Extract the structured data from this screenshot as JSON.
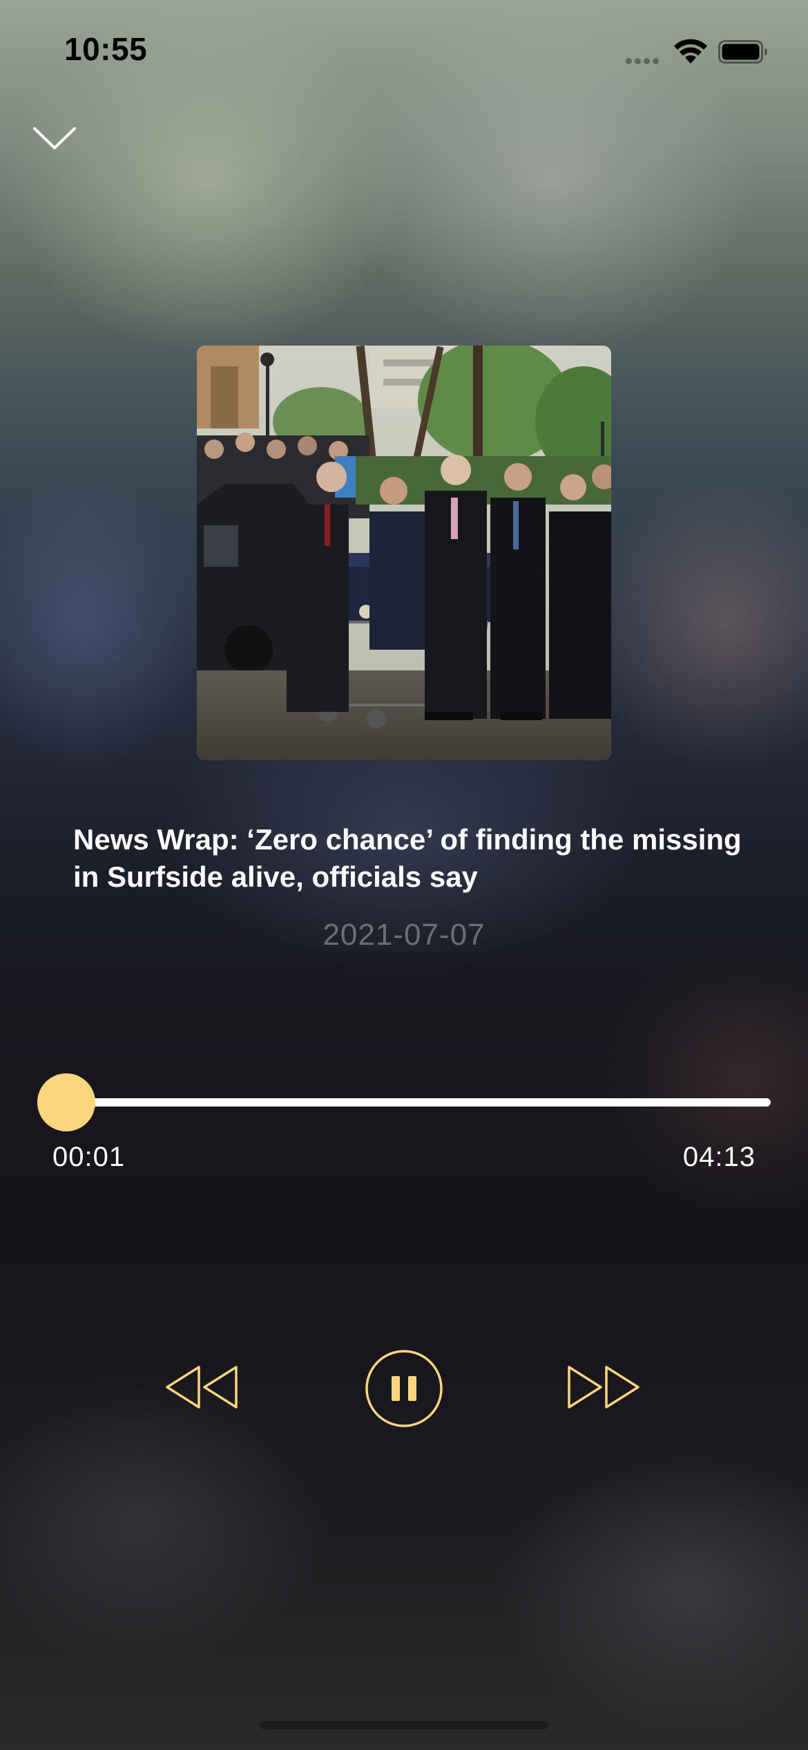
{
  "status_bar": {
    "time": "10:55",
    "signal_icon": "cellular-signal-icon",
    "wifi_icon": "wifi-icon",
    "battery_icon": "battery-icon"
  },
  "navigation": {
    "dismiss_icon": "chevron-down-icon"
  },
  "artwork": {
    "description_icon": "episode-artwork"
  },
  "episode": {
    "title": "News Wrap: ‘Zero chance’ of finding the missing in Surfside alive, officials say",
    "date": "2021-07-07"
  },
  "playback": {
    "elapsed": "00:01",
    "total": "04:13",
    "progress_fraction": 0.004,
    "state": "playing"
  },
  "controls": {
    "rewind_icon": "rewind-icon",
    "pause_icon": "pause-icon",
    "forward_icon": "fast-forward-icon"
  },
  "colors": {
    "accent": "#fdd57e",
    "text": "#ffffff",
    "date_text": "rgba(255,255,255,0.35)"
  }
}
